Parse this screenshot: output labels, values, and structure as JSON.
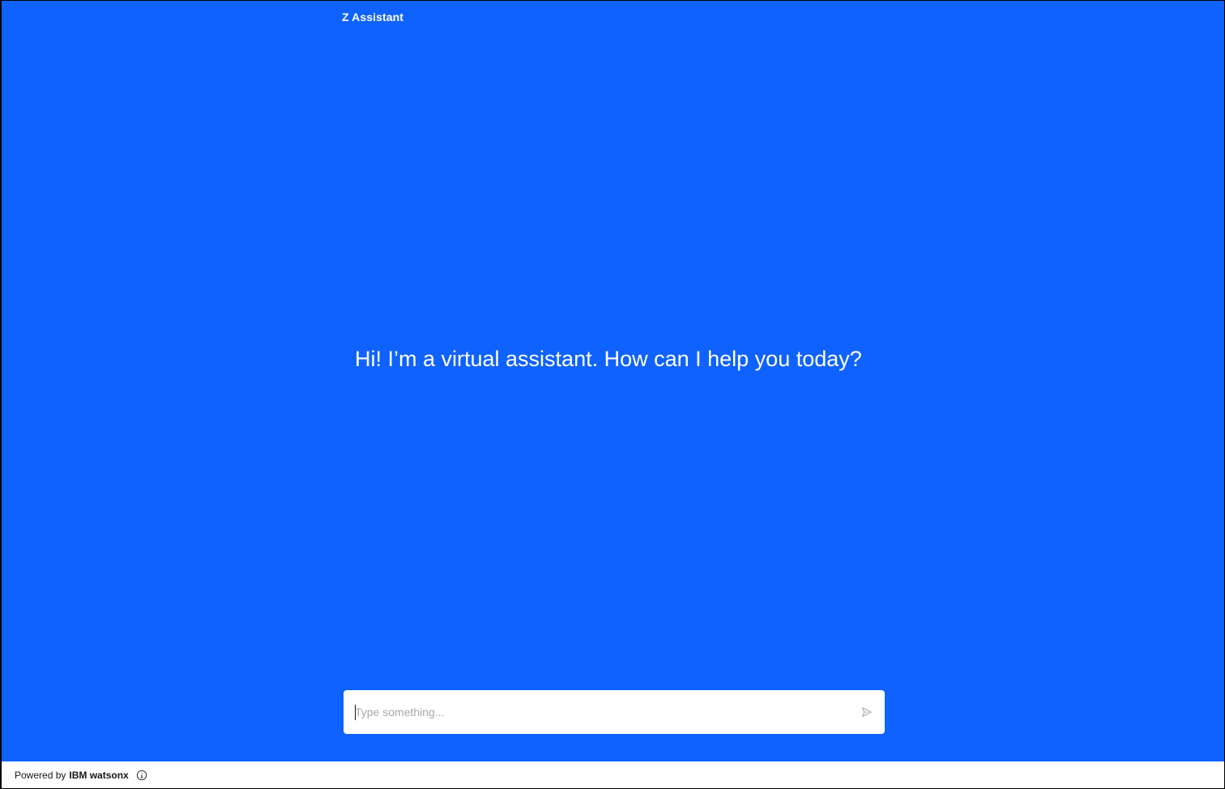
{
  "header": {
    "title": "Z Assistant"
  },
  "chat": {
    "greeting": "Hi! I’m a virtual assistant. How can I help you today?"
  },
  "composer": {
    "placeholder": "Type something...",
    "value": "",
    "send_icon": "send-icon"
  },
  "footer": {
    "powered_by": "Powered by",
    "brand": "IBM watsonx",
    "info_icon": "info-icon"
  },
  "colors": {
    "background": "#0f62fe",
    "text_on_background": "#ffffff",
    "footer_background": "#ffffff",
    "placeholder": "#a8a8a8"
  }
}
